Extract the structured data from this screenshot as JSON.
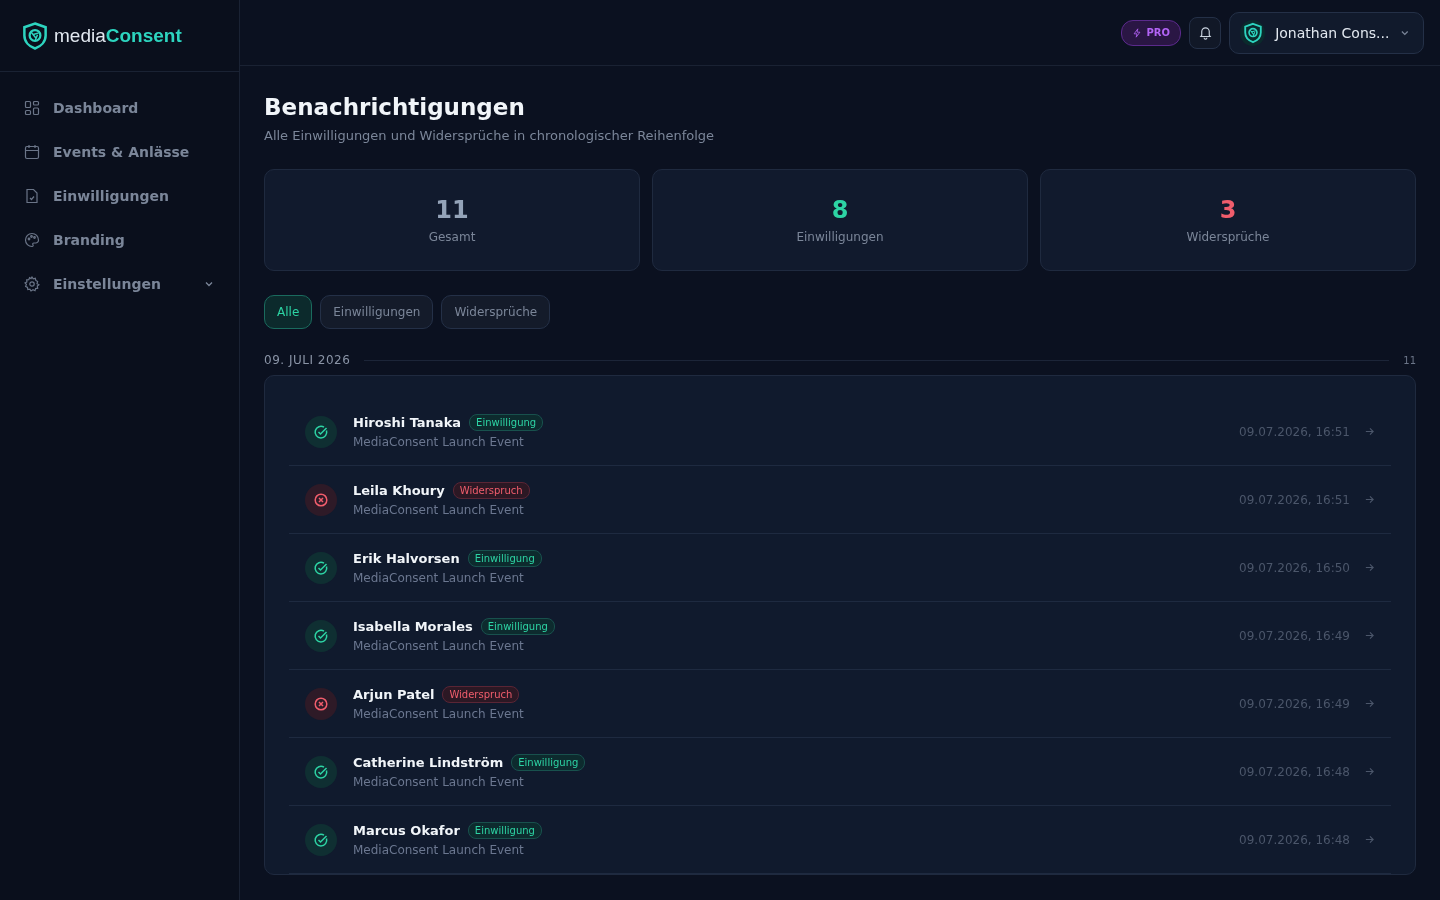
{
  "brand": {
    "name_part1": "media",
    "name_part2": "Consent"
  },
  "sidebar": {
    "items": [
      {
        "label": "Dashboard",
        "kind": "grid",
        "expandable": false
      },
      {
        "label": "Events & Anlässe",
        "kind": "calendar",
        "expandable": false
      },
      {
        "label": "Einwilligungen",
        "kind": "file",
        "expandable": false
      },
      {
        "label": "Branding",
        "kind": "palette",
        "expandable": false
      },
      {
        "label": "Einstellungen",
        "kind": "gear",
        "expandable": true
      }
    ]
  },
  "header": {
    "plan_badge": "PRO",
    "user_name": "Jonathan Cons..."
  },
  "page": {
    "title": "Benachrichtigungen",
    "subtitle": "Alle Einwilligungen und Widersprüche in chronologischer Reihenfolge"
  },
  "stats": [
    {
      "value": "11",
      "label": "Gesamt",
      "color": "#94a3b8"
    },
    {
      "value": "8",
      "label": "Einwilligungen",
      "color": "#2dd4a4"
    },
    {
      "value": "3",
      "label": "Widersprüche",
      "color": "#f05d6c"
    }
  ],
  "filters": [
    {
      "label": "Alle",
      "selected": true
    },
    {
      "label": "Einwilligungen",
      "selected": false
    },
    {
      "label": "Widersprüche",
      "selected": false
    }
  ],
  "group": {
    "date": "09. JULI 2026",
    "count": "11"
  },
  "notifications": [
    {
      "kind": "consent",
      "name": "Hiroshi Tanaka",
      "badge": "Einwilligung",
      "event": "MediaConsent Launch Event",
      "time": "09.07.2026, 16:51"
    },
    {
      "kind": "objection",
      "name": "Leila Khoury",
      "badge": "Widerspruch",
      "event": "MediaConsent Launch Event",
      "time": "09.07.2026, 16:51"
    },
    {
      "kind": "consent",
      "name": "Erik Halvorsen",
      "badge": "Einwilligung",
      "event": "MediaConsent Launch Event",
      "time": "09.07.2026, 16:50"
    },
    {
      "kind": "consent",
      "name": "Isabella Morales",
      "badge": "Einwilligung",
      "event": "MediaConsent Launch Event",
      "time": "09.07.2026, 16:49"
    },
    {
      "kind": "objection",
      "name": "Arjun Patel",
      "badge": "Widerspruch",
      "event": "MediaConsent Launch Event",
      "time": "09.07.2026, 16:49"
    },
    {
      "kind": "consent",
      "name": "Catherine Lindström",
      "badge": "Einwilligung",
      "event": "MediaConsent Launch Event",
      "time": "09.07.2026, 16:48"
    },
    {
      "kind": "consent",
      "name": "Marcus Okafor",
      "badge": "Einwilligung",
      "event": "MediaConsent Launch Event",
      "time": "09.07.2026, 16:48"
    }
  ]
}
